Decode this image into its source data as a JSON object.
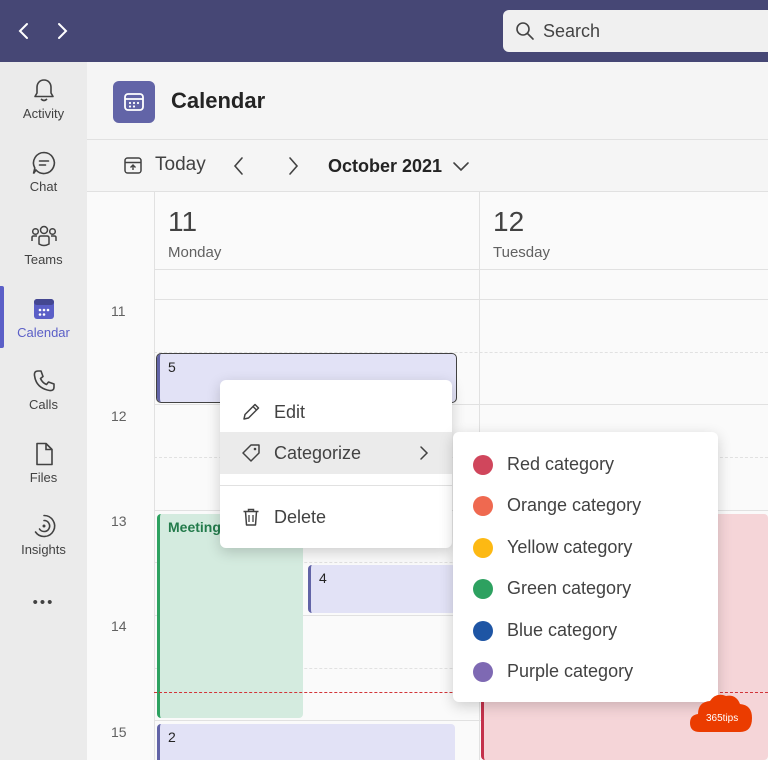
{
  "topbar": {
    "search_placeholder": "Search"
  },
  "rail": {
    "items": [
      {
        "label": "Activity",
        "icon": "bell-icon"
      },
      {
        "label": "Chat",
        "icon": "chat-icon"
      },
      {
        "label": "Teams",
        "icon": "teams-icon"
      },
      {
        "label": "Calendar",
        "icon": "calendar-icon",
        "active": true
      },
      {
        "label": "Calls",
        "icon": "phone-icon"
      },
      {
        "label": "Files",
        "icon": "file-icon"
      },
      {
        "label": "Insights",
        "icon": "insights-icon"
      },
      {
        "label": "•••",
        "icon": "more-icon"
      }
    ]
  },
  "header": {
    "title": "Calendar"
  },
  "toolbar": {
    "today_label": "Today",
    "month_label": "October 2021"
  },
  "days": [
    {
      "num": "11",
      "name": "Monday"
    },
    {
      "num": "12",
      "name": "Tuesday"
    }
  ],
  "hours": [
    "11",
    "12",
    "13",
    "14",
    "15"
  ],
  "events": {
    "e5": "5",
    "meeting": "Meeting",
    "e4": "4",
    "e2": "2"
  },
  "context_menu": {
    "edit": "Edit",
    "categorize": "Categorize",
    "delete": "Delete"
  },
  "categories": [
    {
      "label": "Red category",
      "color": "#d0465c"
    },
    {
      "label": "Orange category",
      "color": "#ef6950"
    },
    {
      "label": "Yellow category",
      "color": "#fdb913"
    },
    {
      "label": "Green category",
      "color": "#2da160"
    },
    {
      "label": "Blue category",
      "color": "#1e55a4"
    },
    {
      "label": "Purple category",
      "color": "#7e69b3"
    }
  ],
  "watermark": {
    "text": "365tips"
  }
}
